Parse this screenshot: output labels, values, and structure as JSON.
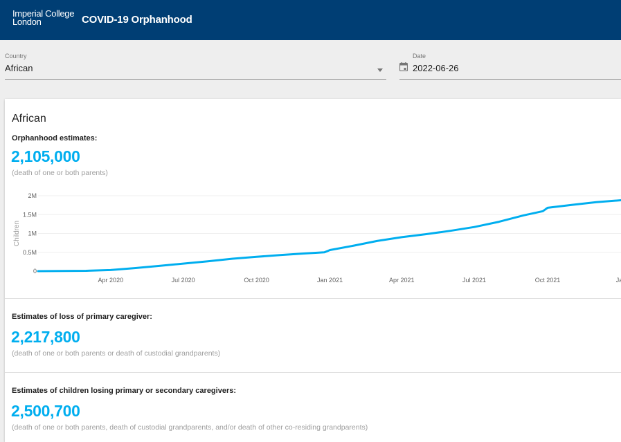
{
  "header": {
    "logo_line1": "Imperial College",
    "logo_line2": "London",
    "title": "COVID-19 Orphanhood",
    "background_color": "#003e74"
  },
  "filters": {
    "country": {
      "label": "Country",
      "value": "African",
      "icon": "chevron-down-icon"
    },
    "date": {
      "label": "Date",
      "value": "2022-06-26",
      "icon": "calendar-icon"
    }
  },
  "summary": {
    "region": "African",
    "orphanhood": {
      "label": "Orphanhood estimates:",
      "value": "2,105,000",
      "note": "(death of one or both parents)"
    },
    "primary_caregiver": {
      "label": "Estimates of loss of primary caregiver:",
      "value": "2,217,800",
      "note": "(death of one or both parents or death of custodial grandparents)"
    },
    "primary_or_secondary": {
      "label": "Estimates of children losing primary or secondary caregivers:",
      "value": "2,500,700",
      "note": "(death of one or both parents, death of custodial grandparents, and/or death of other co-residing grandparents)"
    },
    "accent_color": "#00aeef"
  },
  "chart_data": {
    "type": "line",
    "ylabel": "Children",
    "xlabel": "",
    "y_ticks": [
      {
        "value": 0,
        "label": "0"
      },
      {
        "value": 500000,
        "label": "0.5M"
      },
      {
        "value": 1000000,
        "label": "1M"
      },
      {
        "value": 1500000,
        "label": "1.5M"
      },
      {
        "value": 2000000,
        "label": "2M"
      }
    ],
    "x_ticks": [
      {
        "date": "2020-04-01",
        "label": "Apr 2020"
      },
      {
        "date": "2020-07-01",
        "label": "Jul 2020"
      },
      {
        "date": "2020-10-01",
        "label": "Oct 2020"
      },
      {
        "date": "2021-01-01",
        "label": "Jan 2021"
      },
      {
        "date": "2021-04-01",
        "label": "Apr 2021"
      },
      {
        "date": "2021-07-01",
        "label": "Jul 2021"
      },
      {
        "date": "2021-10-01",
        "label": "Oct 2021"
      },
      {
        "date": "2022-01-01",
        "label": "Jan"
      }
    ],
    "xlim": [
      "2020-01-01",
      "2022-01-01"
    ],
    "ylim": [
      0,
      2000000
    ],
    "grid": true,
    "series": [
      {
        "color": "#00aeef",
        "points": [
          {
            "x": "2020-01-01",
            "y": 0
          },
          {
            "x": "2020-03-01",
            "y": 10000
          },
          {
            "x": "2020-04-01",
            "y": 30000
          },
          {
            "x": "2020-05-01",
            "y": 80000
          },
          {
            "x": "2020-06-01",
            "y": 140000
          },
          {
            "x": "2020-07-01",
            "y": 200000
          },
          {
            "x": "2020-08-01",
            "y": 260000
          },
          {
            "x": "2020-09-01",
            "y": 330000
          },
          {
            "x": "2020-10-01",
            "y": 380000
          },
          {
            "x": "2020-11-01",
            "y": 430000
          },
          {
            "x": "2020-12-01",
            "y": 470000
          },
          {
            "x": "2020-12-25",
            "y": 500000
          },
          {
            "x": "2021-01-01",
            "y": 560000
          },
          {
            "x": "2021-02-01",
            "y": 680000
          },
          {
            "x": "2021-03-01",
            "y": 800000
          },
          {
            "x": "2021-04-01",
            "y": 900000
          },
          {
            "x": "2021-05-01",
            "y": 980000
          },
          {
            "x": "2021-06-01",
            "y": 1070000
          },
          {
            "x": "2021-07-01",
            "y": 1170000
          },
          {
            "x": "2021-08-01",
            "y": 1310000
          },
          {
            "x": "2021-09-01",
            "y": 1480000
          },
          {
            "x": "2021-09-25",
            "y": 1590000
          },
          {
            "x": "2021-10-01",
            "y": 1680000
          },
          {
            "x": "2021-11-01",
            "y": 1760000
          },
          {
            "x": "2021-12-01",
            "y": 1830000
          },
          {
            "x": "2022-01-01",
            "y": 1880000
          }
        ]
      }
    ]
  }
}
